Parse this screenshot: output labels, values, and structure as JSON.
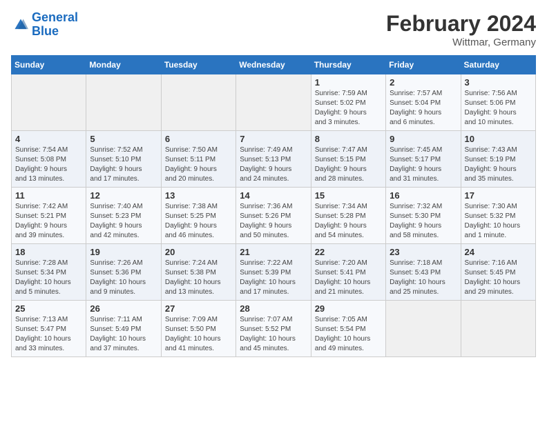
{
  "header": {
    "logo_line1": "General",
    "logo_line2": "Blue",
    "month_title": "February 2024",
    "location": "Wittmar, Germany"
  },
  "weekdays": [
    "Sunday",
    "Monday",
    "Tuesday",
    "Wednesday",
    "Thursday",
    "Friday",
    "Saturday"
  ],
  "weeks": [
    [
      {
        "day": "",
        "info": ""
      },
      {
        "day": "",
        "info": ""
      },
      {
        "day": "",
        "info": ""
      },
      {
        "day": "",
        "info": ""
      },
      {
        "day": "1",
        "info": "Sunrise: 7:59 AM\nSunset: 5:02 PM\nDaylight: 9 hours\nand 3 minutes."
      },
      {
        "day": "2",
        "info": "Sunrise: 7:57 AM\nSunset: 5:04 PM\nDaylight: 9 hours\nand 6 minutes."
      },
      {
        "day": "3",
        "info": "Sunrise: 7:56 AM\nSunset: 5:06 PM\nDaylight: 9 hours\nand 10 minutes."
      }
    ],
    [
      {
        "day": "4",
        "info": "Sunrise: 7:54 AM\nSunset: 5:08 PM\nDaylight: 9 hours\nand 13 minutes."
      },
      {
        "day": "5",
        "info": "Sunrise: 7:52 AM\nSunset: 5:10 PM\nDaylight: 9 hours\nand 17 minutes."
      },
      {
        "day": "6",
        "info": "Sunrise: 7:50 AM\nSunset: 5:11 PM\nDaylight: 9 hours\nand 20 minutes."
      },
      {
        "day": "7",
        "info": "Sunrise: 7:49 AM\nSunset: 5:13 PM\nDaylight: 9 hours\nand 24 minutes."
      },
      {
        "day": "8",
        "info": "Sunrise: 7:47 AM\nSunset: 5:15 PM\nDaylight: 9 hours\nand 28 minutes."
      },
      {
        "day": "9",
        "info": "Sunrise: 7:45 AM\nSunset: 5:17 PM\nDaylight: 9 hours\nand 31 minutes."
      },
      {
        "day": "10",
        "info": "Sunrise: 7:43 AM\nSunset: 5:19 PM\nDaylight: 9 hours\nand 35 minutes."
      }
    ],
    [
      {
        "day": "11",
        "info": "Sunrise: 7:42 AM\nSunset: 5:21 PM\nDaylight: 9 hours\nand 39 minutes."
      },
      {
        "day": "12",
        "info": "Sunrise: 7:40 AM\nSunset: 5:23 PM\nDaylight: 9 hours\nand 42 minutes."
      },
      {
        "day": "13",
        "info": "Sunrise: 7:38 AM\nSunset: 5:25 PM\nDaylight: 9 hours\nand 46 minutes."
      },
      {
        "day": "14",
        "info": "Sunrise: 7:36 AM\nSunset: 5:26 PM\nDaylight: 9 hours\nand 50 minutes."
      },
      {
        "day": "15",
        "info": "Sunrise: 7:34 AM\nSunset: 5:28 PM\nDaylight: 9 hours\nand 54 minutes."
      },
      {
        "day": "16",
        "info": "Sunrise: 7:32 AM\nSunset: 5:30 PM\nDaylight: 9 hours\nand 58 minutes."
      },
      {
        "day": "17",
        "info": "Sunrise: 7:30 AM\nSunset: 5:32 PM\nDaylight: 10 hours\nand 1 minute."
      }
    ],
    [
      {
        "day": "18",
        "info": "Sunrise: 7:28 AM\nSunset: 5:34 PM\nDaylight: 10 hours\nand 5 minutes."
      },
      {
        "day": "19",
        "info": "Sunrise: 7:26 AM\nSunset: 5:36 PM\nDaylight: 10 hours\nand 9 minutes."
      },
      {
        "day": "20",
        "info": "Sunrise: 7:24 AM\nSunset: 5:38 PM\nDaylight: 10 hours\nand 13 minutes."
      },
      {
        "day": "21",
        "info": "Sunrise: 7:22 AM\nSunset: 5:39 PM\nDaylight: 10 hours\nand 17 minutes."
      },
      {
        "day": "22",
        "info": "Sunrise: 7:20 AM\nSunset: 5:41 PM\nDaylight: 10 hours\nand 21 minutes."
      },
      {
        "day": "23",
        "info": "Sunrise: 7:18 AM\nSunset: 5:43 PM\nDaylight: 10 hours\nand 25 minutes."
      },
      {
        "day": "24",
        "info": "Sunrise: 7:16 AM\nSunset: 5:45 PM\nDaylight: 10 hours\nand 29 minutes."
      }
    ],
    [
      {
        "day": "25",
        "info": "Sunrise: 7:13 AM\nSunset: 5:47 PM\nDaylight: 10 hours\nand 33 minutes."
      },
      {
        "day": "26",
        "info": "Sunrise: 7:11 AM\nSunset: 5:49 PM\nDaylight: 10 hours\nand 37 minutes."
      },
      {
        "day": "27",
        "info": "Sunrise: 7:09 AM\nSunset: 5:50 PM\nDaylight: 10 hours\nand 41 minutes."
      },
      {
        "day": "28",
        "info": "Sunrise: 7:07 AM\nSunset: 5:52 PM\nDaylight: 10 hours\nand 45 minutes."
      },
      {
        "day": "29",
        "info": "Sunrise: 7:05 AM\nSunset: 5:54 PM\nDaylight: 10 hours\nand 49 minutes."
      },
      {
        "day": "",
        "info": ""
      },
      {
        "day": "",
        "info": ""
      }
    ]
  ]
}
